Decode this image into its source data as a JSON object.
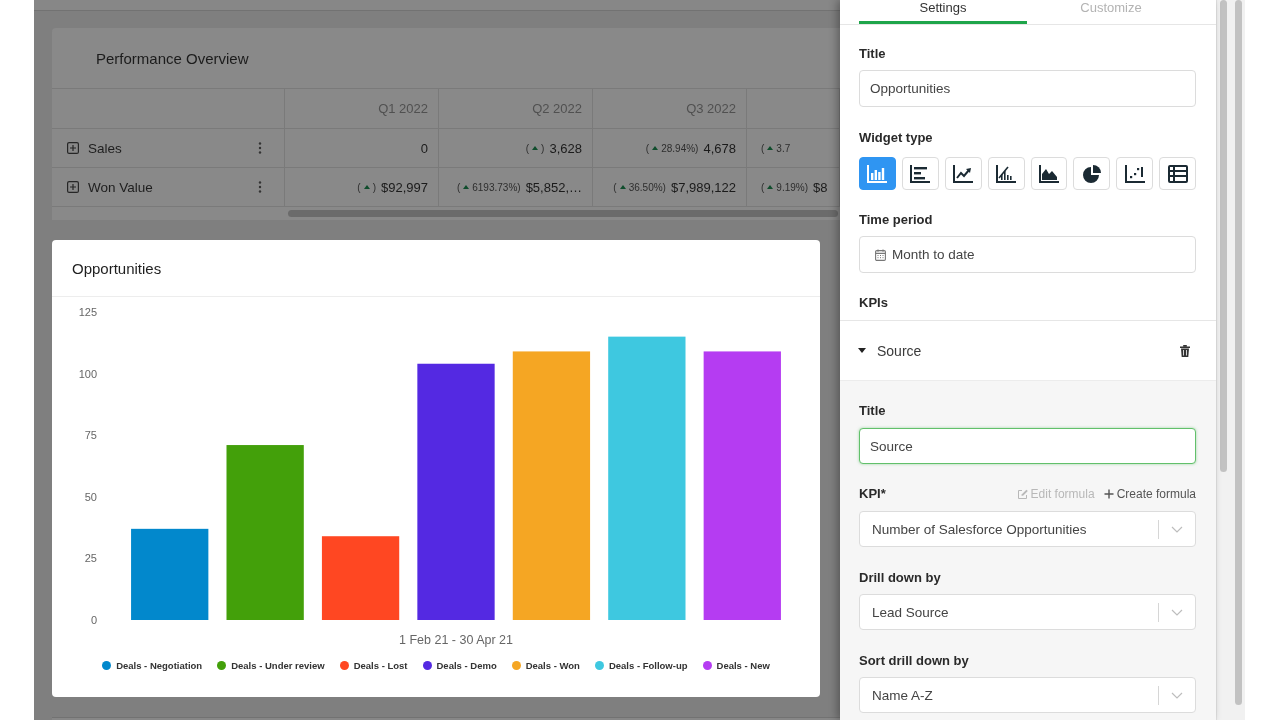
{
  "dashboard": {
    "performance_table": {
      "title": "Performance Overview",
      "columns": [
        "Q1 2022",
        "Q2 2022",
        "Q3 2022"
      ],
      "rows": [
        {
          "label": "Sales",
          "cells": [
            {
              "value": "0"
            },
            {
              "delta_before": "(",
              "up": true,
              "delta_after": ")",
              "value": "3,628"
            },
            {
              "delta_before": "(",
              "up": true,
              "delta_after": "28.94%)",
              "value": "4,678"
            },
            {
              "delta_before": "(",
              "up": true,
              "delta_after": "3.7"
            }
          ]
        },
        {
          "label": "Won Value",
          "cells": [
            {
              "delta_before": "(",
              "up": true,
              "delta_after": ")",
              "value": "$92,997"
            },
            {
              "delta_before": "(",
              "up": true,
              "delta_after": "6193.73%)",
              "value": "$5,852,…"
            },
            {
              "delta_before": "(",
              "up": true,
              "delta_after": "36.50%)",
              "value": "$7,989,122"
            },
            {
              "delta_before": "(",
              "up": true,
              "delta_after": "9.19%)",
              "value": "$8"
            }
          ]
        }
      ]
    },
    "chart_widget": {
      "chart_data": {
        "type": "bar",
        "title": "Opportunities",
        "xlabel": "1 Feb 21 - 30 Apr 21",
        "series": [
          {
            "name": "Deals - Negotiation",
            "color": "#0288cc",
            "values": [
              37
            ]
          },
          {
            "name": "Deals - Under review",
            "color": "#43a00a",
            "values": [
              71
            ]
          },
          {
            "name": "Deals - Lost",
            "color": "#ff4722",
            "values": [
              34
            ]
          },
          {
            "name": "Deals - Demo",
            "color": "#5429e2",
            "values": [
              104
            ]
          },
          {
            "name": "Deals - Won",
            "color": "#f5a623",
            "values": [
              109
            ]
          },
          {
            "name": "Deals - Follow-up",
            "color": "#3ec8e0",
            "values": [
              115
            ]
          },
          {
            "name": "Deals - New",
            "color": "#b53cf2",
            "values": [
              109
            ]
          }
        ],
        "ylim": [
          0,
          125
        ],
        "yticks": [
          {
            "value": 0,
            "label": "0"
          },
          {
            "value": 25,
            "label": "25"
          },
          {
            "value": 50,
            "label": "50"
          },
          {
            "value": 75,
            "label": "75"
          },
          {
            "value": 100,
            "label": "100"
          },
          {
            "value": 125,
            "label": "125"
          }
        ],
        "legend": "bottom"
      }
    }
  },
  "settings_panel": {
    "tabs": [
      {
        "label": "Settings",
        "selected": true
      },
      {
        "label": "Customize",
        "selected": false
      }
    ],
    "title_field": {
      "label": "Title",
      "value": "Opportunities"
    },
    "widget_type": {
      "label": "Widget type",
      "options": [
        {
          "kind": "column",
          "selected": true
        },
        {
          "kind": "bar",
          "selected": false
        },
        {
          "kind": "line",
          "selected": false
        },
        {
          "kind": "combo",
          "selected": false
        },
        {
          "kind": "area",
          "selected": false
        },
        {
          "kind": "pie",
          "selected": false
        },
        {
          "kind": "scatter",
          "selected": false
        },
        {
          "kind": "table",
          "selected": false
        }
      ]
    },
    "time_period": {
      "label": "Time period",
      "value": "Month to date"
    },
    "kpis": {
      "label": "KPIs",
      "items": [
        {
          "name": "Source",
          "expanded": true,
          "title_field": {
            "label": "Title",
            "value": "Source",
            "focused": true
          },
          "kpi_field": {
            "label": "KPI*",
            "value": "Number of Salesforce Opportunities"
          },
          "formula_links": [
            {
              "kind": "edit",
              "label": "Edit formula",
              "disabled": true
            },
            {
              "kind": "create",
              "label": "Create formula",
              "disabled": false
            }
          ],
          "drill_down": {
            "label": "Drill down by",
            "value": "Lead Source"
          },
          "sort_drill_down": {
            "label": "Sort drill down by",
            "value": "Name A-Z"
          }
        }
      ]
    }
  }
}
